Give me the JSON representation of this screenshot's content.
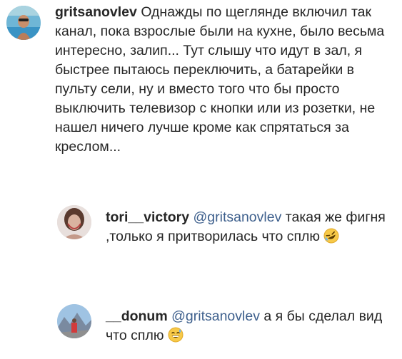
{
  "comments": [
    {
      "username": "gritsanovlev",
      "mention": "",
      "text": "Однажды по щеглянде включил так канал, пока взрослые были на кухне, было весьма интересно, залип... Тут слышу что идут в зал, я быстрее пытаюсь переключить, а батарейки в пульту сели, ну и вместо того что бы просто выключить телевизор с кнопки или из розетки, не нашел ничего лучше кроме как спрятаться за креслом...",
      "avatar_icon": "user-avatar-pool-photo"
    },
    {
      "username": "tori__victory",
      "mention": "@gritsanovlev",
      "text": "такая же фигня ,только я притворилась что сплю",
      "emoji": "rolling-on-floor-laughing-emoji",
      "avatar_icon": "user-avatar-portrait-photo"
    },
    {
      "username": "__donum",
      "mention": "@gritsanovlev",
      "text": "а я бы сделал вид что сплю",
      "emoji": "grinning-sweat-emoji",
      "avatar_icon": "user-avatar-mountain-photo"
    }
  ],
  "colors": {
    "text": "#262626",
    "mention": "#3d5f8c",
    "emoji_face": "#f7c948"
  }
}
